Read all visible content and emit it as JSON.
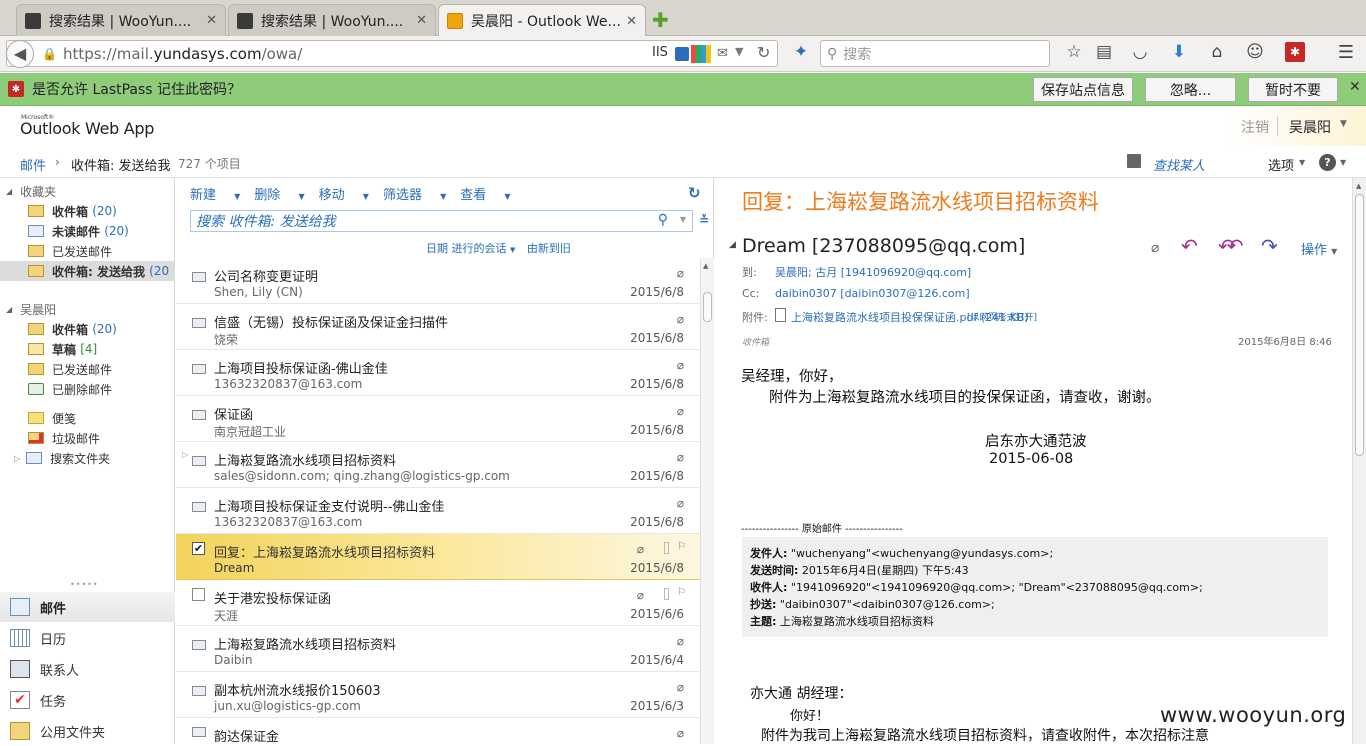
{
  "browser": {
    "tabs": [
      {
        "title": "搜索结果 | WooYun....",
        "active": false
      },
      {
        "title": "搜索结果 | WooYun....",
        "active": false
      },
      {
        "title": "吴晨阳 - Outlook We...",
        "active": true
      }
    ],
    "url_prefix": "https://mail.",
    "url_domain": "yundasys.com",
    "url_path": "/owa/",
    "iis_label": "IIS",
    "search_placeholder": "搜索"
  },
  "lastpass": {
    "question": "是否允许 LastPass 记住此密码？",
    "save_label": "保存站点信息",
    "ignore_label": "忽略...",
    "not_now_label": "暂时不要"
  },
  "owa": {
    "brand_small": "Microsoft®",
    "brand": "Outlook Web App",
    "signout_label": "注销",
    "user_name": "吴晨阳",
    "find_someone": "查找某人",
    "options_label": "选项",
    "help_label": "?"
  },
  "breadcrumb": {
    "root": "邮件",
    "current": "收件箱: 发送给我",
    "count": "727 个项目"
  },
  "leftnav": {
    "favorites_header": "收藏夹",
    "favorites": [
      {
        "label": "收件箱",
        "count": "(20)",
        "bold": true
      },
      {
        "label": "未读邮件",
        "count": "(20)",
        "bold": true
      },
      {
        "label": "已发送邮件",
        "count": "",
        "bold": false
      },
      {
        "label": "收件箱: 发送给我",
        "count": "(20",
        "bold": true
      }
    ],
    "mailbox_header": "吴晨阳",
    "mailbox": [
      {
        "label": "收件箱",
        "count": "(20)"
      },
      {
        "label": "草稿",
        "count": "[4]"
      },
      {
        "label": "已发送邮件",
        "count": ""
      },
      {
        "label": "已删除邮件",
        "count": ""
      }
    ],
    "other": [
      {
        "label": "便笺"
      },
      {
        "label": "垃圾邮件"
      },
      {
        "label": "搜索文件夹"
      }
    ],
    "dots": "•••••",
    "bottom_nav": [
      {
        "label": "邮件",
        "icon": "mail-icon"
      },
      {
        "label": "日历",
        "icon": "calendar-icon"
      },
      {
        "label": "联系人",
        "icon": "contacts-icon"
      },
      {
        "label": "任务",
        "icon": "tasks-icon"
      },
      {
        "label": "公用文件夹",
        "icon": "public-folder-icon"
      }
    ]
  },
  "list": {
    "tools": [
      "新建",
      "删除",
      "移动",
      "筛选器",
      "查看"
    ],
    "search_placeholder": "搜索 收件箱: 发送给我",
    "sort_label": "日期 进行的会话",
    "sort_order": "由新到旧",
    "messages": [
      {
        "subject": "公司名称变更证明",
        "from": "Shen, Lily (CN)",
        "date": "2015/6/8",
        "selected": false
      },
      {
        "subject": "信盛（无锡）投标保证函及保证金扫描件",
        "from": "饶荣",
        "date": "2015/6/8",
        "selected": false
      },
      {
        "subject": "上海项目投标保证函-佛山金佳",
        "from": "13632320837@163.com",
        "date": "2015/6/8",
        "selected": false
      },
      {
        "subject": "保证函",
        "from": "南京冠超工业",
        "date": "2015/6/8",
        "selected": false
      },
      {
        "subject": "上海崧复路流水线项目招标资料",
        "from": "sales@sidonn.com; qing.zhang@logistics-gp.com",
        "date": "2015/6/8",
        "selected": false
      },
      {
        "subject": "上海项目投标保证金支付说明--佛山金佳",
        "from": "13632320837@163.com",
        "date": "2015/6/8",
        "selected": false
      },
      {
        "subject": "回复：上海崧复路流水线项目招标资料",
        "from": "Dream",
        "date": "2015/6/8",
        "selected": true
      },
      {
        "subject": "关于港宏投标保证函",
        "from": "天涯",
        "date": "2015/6/6",
        "selected": false
      },
      {
        "subject": "上海崧复路流水线项目招标资料",
        "from": "Daibin",
        "date": "2015/6/4",
        "selected": false
      },
      {
        "subject": "副本杭州流水线报价150603",
        "from": "jun.xu@logistics-gp.com",
        "date": "2015/6/3",
        "selected": false
      },
      {
        "subject": "韵达保证金",
        "from": "",
        "date": "",
        "selected": false
      }
    ]
  },
  "reading": {
    "title": "回复：上海崧复路流水线项目招标资料",
    "sender": "Dream [237088095@qq.com]",
    "actions_label": "操作",
    "to_label": "到:",
    "to_value": "吴晨阳; 古月 [1941096920@qq.com]",
    "cc_label": "Cc:",
    "cc_value": "daibin0307 [daibin0307@126.com]",
    "attach_label": "附件:",
    "attach_name": "上海崧复路流水线项目投保保证函.pdf (241 KB)",
    "attach_open": "[以网页形式打开]",
    "folder": "收件箱",
    "sent": "2015年6月8日 8:46",
    "body_greeting": "吴经理，你好，",
    "body_line": "附件为上海崧复路流水线项目的投保保证函，请查收，谢谢。",
    "sign_name": "启东亦大通范波",
    "sign_date": "2015-06-08",
    "orig_sep": "---------------- 原始邮件 ----------------",
    "orig_from_label": "发件人:",
    "orig_from": " \"wuchenyang\"<wuchenyang@yundasys.com>;",
    "orig_time_label": "发送时间:",
    "orig_time": " 2015年6月4日(星期四) 下午5:43",
    "orig_to_label": "收件人:",
    "orig_to": " \"1941096920\"<1941096920@qq.com>; \"Dream\"<237088095@qq.com>;",
    "orig_cc_label": "抄送:",
    "orig_cc": " \"daibin0307\"<daibin0307@126.com>;",
    "orig_subj_label": "主题:",
    "orig_subj": " 上海崧复路流水线项目招标资料",
    "body2_greeting": "亦大通  胡经理：",
    "body2_hello": "你好！",
    "body2_line": "附件为我司上海崧复路流水线项目招标资料，请查收附件，本次招标注意"
  },
  "watermark": "www.wooyun.org",
  "colors": {
    "accent_orange": "#f07b1a",
    "link_blue": "#2a6ebb",
    "lastpass_green": "#8ecb7b",
    "reply_purple": "#a0308a"
  }
}
